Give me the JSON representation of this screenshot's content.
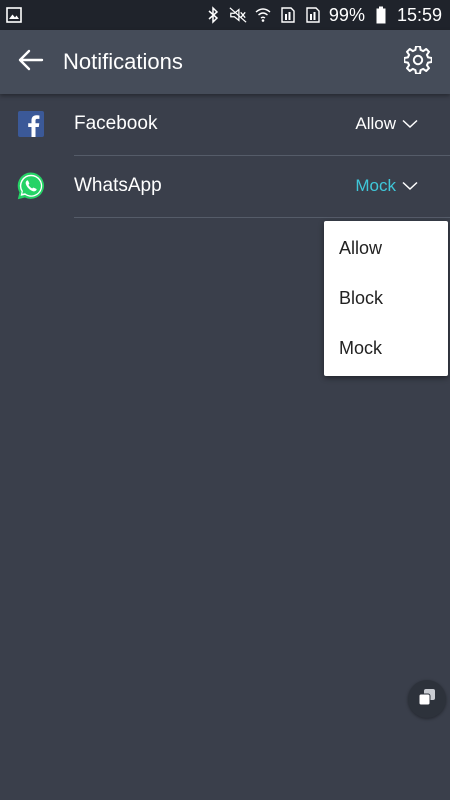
{
  "status_bar": {
    "battery": "99%",
    "time": "15:59",
    "icons": [
      "gallery-icon",
      "bluetooth-icon",
      "mute-icon",
      "wifi-icon",
      "sim1-icon",
      "sim2-icon",
      "battery-icon"
    ]
  },
  "app_bar": {
    "title": "Notifications",
    "back_icon": "arrow-left-icon",
    "settings_icon": "gear-icon"
  },
  "apps": [
    {
      "name": "Facebook",
      "permission": "Allow",
      "icon": "facebook-icon",
      "permission_color": "#ffffff"
    },
    {
      "name": "WhatsApp",
      "permission": "Mock",
      "icon": "whatsapp-icon",
      "permission_color": "#3fc7d9"
    }
  ],
  "dropdown": {
    "options": [
      "Allow",
      "Block",
      "Mock"
    ]
  },
  "colors": {
    "background": "#3a3f4b",
    "app_bar": "#454c59",
    "status_bar": "#1f232b",
    "accent": "#3fc7d9",
    "facebook_blue": "#3b5998",
    "whatsapp_green": "#25d366"
  }
}
